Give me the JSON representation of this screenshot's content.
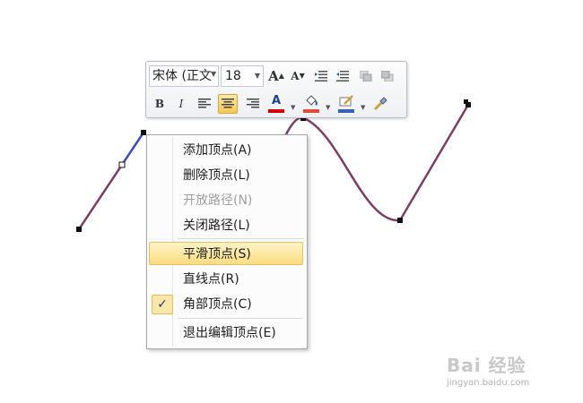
{
  "toolbar": {
    "font_name": "宋体 (正文",
    "font_size": "18",
    "buttons": {
      "grow_font": "A",
      "shrink_font": "A",
      "bold": "B",
      "italic": "I",
      "font_color": "A"
    },
    "colors": {
      "font_color": "#cc0000",
      "fill_color": "#d94f3b",
      "outline_color": "#3a62b3",
      "active_bg": "#f7c856"
    }
  },
  "context_menu": {
    "items": [
      {
        "label": "添加顶点(A)",
        "state": "normal"
      },
      {
        "label": "删除顶点(L)",
        "state": "normal"
      },
      {
        "label": "开放路径(N)",
        "state": "disabled"
      },
      {
        "label": "关闭路径(L)",
        "state": "normal"
      },
      {
        "label": "平滑顶点(S)",
        "state": "hover"
      },
      {
        "label": "直线点(R)",
        "state": "normal"
      },
      {
        "label": "角部顶点(C)",
        "state": "checked"
      },
      {
        "label": "退出编辑顶点(E)",
        "state": "normal"
      }
    ],
    "check_glyph": "✓"
  },
  "shape": {
    "line_color": "#7a3f63",
    "edit_color": "#3350c8"
  },
  "watermark": {
    "main": "Bai 经验",
    "sub": "jingyan.baidu.com"
  }
}
